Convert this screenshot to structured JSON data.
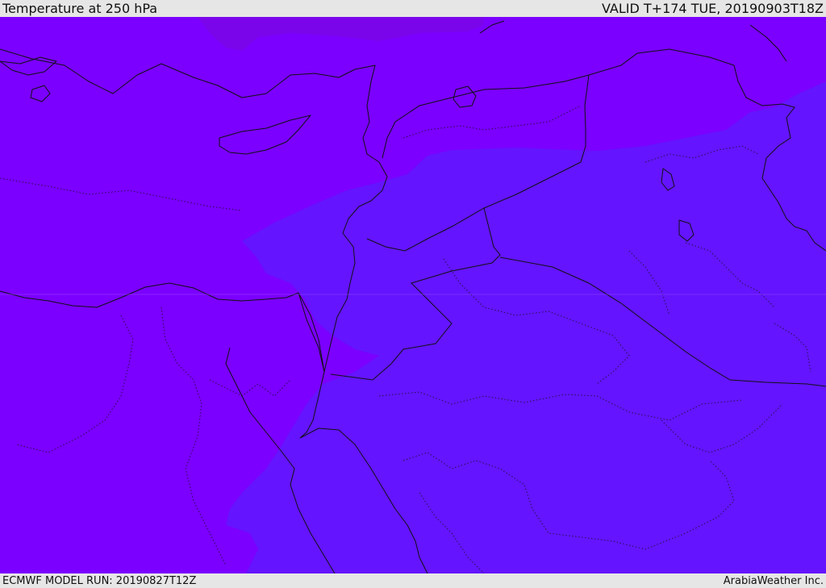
{
  "header": {
    "title": "Temperature at 250 hPa",
    "valid": "VALID T+174 TUE, 20190903T18Z"
  },
  "footer": {
    "model_run": "ECMWF MODEL RUN: 20190827T12Z",
    "credit": "ArabiaWeather Inc."
  },
  "colors": {
    "warm_band": "#7b00ff",
    "cool_band": "#6414ff",
    "warmest_patch": "#7a06e8",
    "bar_background": "#e6e6e6",
    "line": "#111111"
  }
}
